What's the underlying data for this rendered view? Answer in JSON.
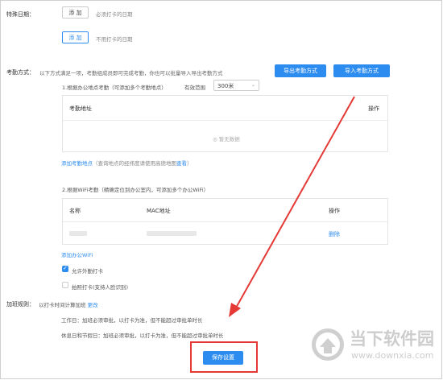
{
  "special_date": {
    "label": "特殊日期：",
    "add_required": "添 加",
    "required_hint": "必须打卡的日期",
    "add_optional": "添 加",
    "optional_hint": "不用打卡的日期"
  },
  "attendance": {
    "label": "考勤方式：",
    "desc": "以下方式满足一项，考勤组成员即可完成考勤，你也可以批量导入导出考勤方式",
    "export_btn": "导出考勤方式",
    "import_btn": "导入考勤方式",
    "location_title": "1.根据办公地点考勤（可添加多个考勤地点）",
    "range_label": "有效范围",
    "range_value": "300米",
    "loc_col_address": "考勤地址",
    "loc_col_action": "操作",
    "empty_text": "暂无数据",
    "add_location": "添加考勤地点",
    "add_location_hint": "（查询地点的经纬度请使用高德地图",
    "view_link": "查看",
    "hint_close": "）",
    "wifi_title": "2.根据WiFi考勤（精确定位到办公室内，可添加多个办公WiFi）",
    "wifi_col_name": "名称",
    "wifi_col_mac": "MAC地址",
    "wifi_col_action": "操作",
    "delete_link": "删除",
    "add_wifi": "添加办公WiFi",
    "allow_outside": "允许外勤打卡",
    "photo_checkin": "拍照打卡(支持人脸识别)"
  },
  "overtime": {
    "label": "加班规则：",
    "rule": "以打卡时间计算加班",
    "change_link": "更改",
    "workday": "工作日：加班必须审批，以打卡为准，但不能超过审批单时长",
    "holiday": "休息日和节假日：加班必须审批，以打卡为准，但不能超过审批单时长"
  },
  "save_btn": "保存设置",
  "watermark": {
    "brand": "当下软件园",
    "url": "www.downxia.com"
  },
  "colors": {
    "accent": "#2d8cf0",
    "highlight_border": "#e53935",
    "arrow": "#e53935"
  }
}
